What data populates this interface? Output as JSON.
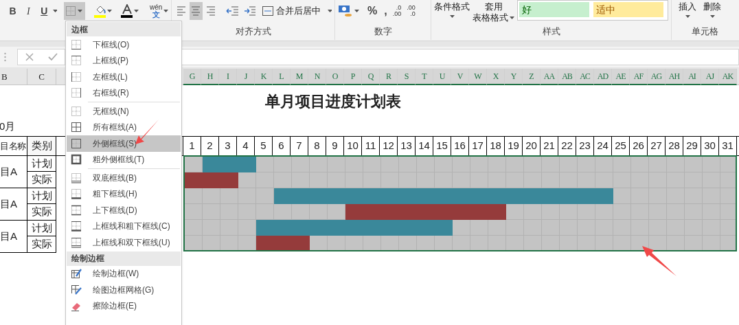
{
  "ribbon": {
    "font_buttons": [
      {
        "label": "B",
        "kind": "bold"
      },
      {
        "label": "I",
        "kind": "italic"
      },
      {
        "label": "U",
        "kind": "underline"
      }
    ],
    "border_button": {
      "selected": true
    },
    "phonetic": {
      "top": "wén",
      "bottom": "文"
    },
    "align_buttons": [
      {
        "selected": false
      },
      {
        "selected": true
      },
      {
        "selected": false
      }
    ],
    "merge_button": "合并后居中",
    "alignment_label": "对齐方式",
    "percent": "%",
    "comma": ",",
    "decimal_buttons": [
      {
        "top": ".0",
        "bottom": ".00"
      },
      {
        "top": ".00",
        "bottom": ".0"
      }
    ],
    "number_label": "数字",
    "conditional_format": "条件格式",
    "table_format": [
      "套用",
      "表格格式"
    ],
    "gallery": [
      {
        "label": "好",
        "kind": "good"
      },
      {
        "label": "适中",
        "kind": "neutral"
      }
    ],
    "styles_label": "样式",
    "cell_buttons": [
      "插入",
      "删除"
    ],
    "cells_label": "单元格"
  },
  "sheet": {
    "left_columns": [
      "B",
      "C"
    ],
    "right_columns": [
      "G",
      "H",
      "I",
      "J",
      "K",
      "L",
      "M",
      "N",
      "O",
      "P",
      "Q",
      "R",
      "S",
      "T",
      "U",
      "V",
      "W",
      "X",
      "Y",
      "Z",
      "AA",
      "AB",
      "AC",
      "AD",
      "AE",
      "AF",
      "AG",
      "AH",
      "AI",
      "AJ",
      "AK"
    ],
    "title": "单月项目进度计划表",
    "month": "0月",
    "headers": [
      "目名称",
      "类别"
    ],
    "days": [
      "1",
      "2",
      "3",
      "4",
      "5",
      "6",
      "7",
      "8",
      "9",
      "10",
      "11",
      "12",
      "13",
      "14",
      "15",
      "16",
      "17",
      "18",
      "19",
      "20",
      "21",
      "22",
      "23",
      "24",
      "25",
      "26",
      "27",
      "28",
      "29",
      "30",
      "31"
    ],
    "projects": [
      {
        "name": "目A",
        "rows": [
          {
            "label": "计划",
            "kind": "plan",
            "filled": [
              false,
              true,
              true,
              true,
              false,
              false,
              false,
              false,
              false,
              false,
              false,
              false,
              false,
              false,
              false,
              false,
              false,
              false,
              false,
              false,
              false,
              false,
              false,
              false,
              false,
              false,
              false,
              false,
              false,
              false,
              false
            ]
          },
          {
            "label": "实际",
            "kind": "actual",
            "filled": [
              true,
              true,
              true,
              false,
              false,
              false,
              false,
              false,
              false,
              false,
              false,
              false,
              false,
              false,
              false,
              false,
              false,
              false,
              false,
              false,
              false,
              false,
              false,
              false,
              false,
              false,
              false,
              false,
              false,
              false,
              false
            ]
          }
        ]
      },
      {
        "name": "目A",
        "rows": [
          {
            "label": "计划",
            "kind": "plan",
            "filled": [
              false,
              false,
              false,
              false,
              false,
              true,
              true,
              true,
              true,
              true,
              true,
              true,
              true,
              true,
              true,
              true,
              true,
              true,
              true,
              true,
              true,
              true,
              true,
              true,
              false,
              false,
              false,
              false,
              false,
              false,
              false
            ]
          },
          {
            "label": "实际",
            "kind": "actual",
            "filled": [
              false,
              false,
              false,
              false,
              false,
              false,
              false,
              false,
              false,
              true,
              true,
              true,
              true,
              true,
              true,
              true,
              true,
              true,
              false,
              false,
              false,
              false,
              false,
              false,
              false,
              false,
              false,
              false,
              false,
              false,
              false
            ]
          }
        ]
      },
      {
        "name": "目A",
        "rows": [
          {
            "label": "计划",
            "kind": "plan",
            "filled": [
              false,
              false,
              false,
              false,
              true,
              true,
              true,
              true,
              true,
              true,
              true,
              true,
              true,
              true,
              true,
              false,
              false,
              false,
              false,
              false,
              false,
              false,
              false,
              false,
              false,
              false,
              false,
              false,
              false,
              false,
              false
            ]
          },
          {
            "label": "实际",
            "kind": "actual",
            "filled": [
              false,
              false,
              false,
              false,
              true,
              true,
              true,
              false,
              false,
              false,
              false,
              false,
              false,
              false,
              false,
              false,
              false,
              false,
              false,
              false,
              false,
              false,
              false,
              false,
              false,
              false,
              false,
              false,
              false,
              false,
              false
            ]
          }
        ]
      }
    ]
  },
  "border_menu": {
    "sections": [
      {
        "title": "边框",
        "groups": [
          [
            {
              "label": "下框线(O)",
              "kind": "bottom",
              "selected": false
            },
            {
              "label": "上框线(P)",
              "kind": "top",
              "selected": false
            },
            {
              "label": "左框线(L)",
              "kind": "left",
              "selected": false
            },
            {
              "label": "右框线(R)",
              "kind": "right",
              "selected": false
            }
          ],
          [
            {
              "label": "无框线(N)",
              "kind": "none",
              "selected": false
            },
            {
              "label": "所有框线(A)",
              "kind": "all",
              "selected": false
            },
            {
              "label": "外侧框线(S)",
              "kind": "outside",
              "selected": true
            },
            {
              "label": "粗外侧框线(T)",
              "kind": "thick-outside",
              "selected": false
            }
          ],
          [
            {
              "label": "双底框线(B)",
              "kind": "double-bottom",
              "selected": false
            },
            {
              "label": "粗下框线(H)",
              "kind": "thick-bottom",
              "selected": false
            },
            {
              "label": "上下框线(D)",
              "kind": "top-bottom",
              "selected": false
            },
            {
              "label": "上框线和粗下框线(C)",
              "kind": "top-thick-bottom",
              "selected": false
            },
            {
              "label": "上框线和双下框线(U)",
              "kind": "top-double-bottom",
              "selected": false
            }
          ]
        ]
      },
      {
        "title": "绘制边框",
        "groups": [
          [
            {
              "label": "绘制边框(W)",
              "kind": "draw",
              "selected": false
            },
            {
              "label": "绘图边框网格(G)",
              "kind": "draw-grid",
              "selected": false
            },
            {
              "label": "擦除边框(E)",
              "kind": "erase",
              "selected": false
            }
          ]
        ]
      }
    ]
  }
}
